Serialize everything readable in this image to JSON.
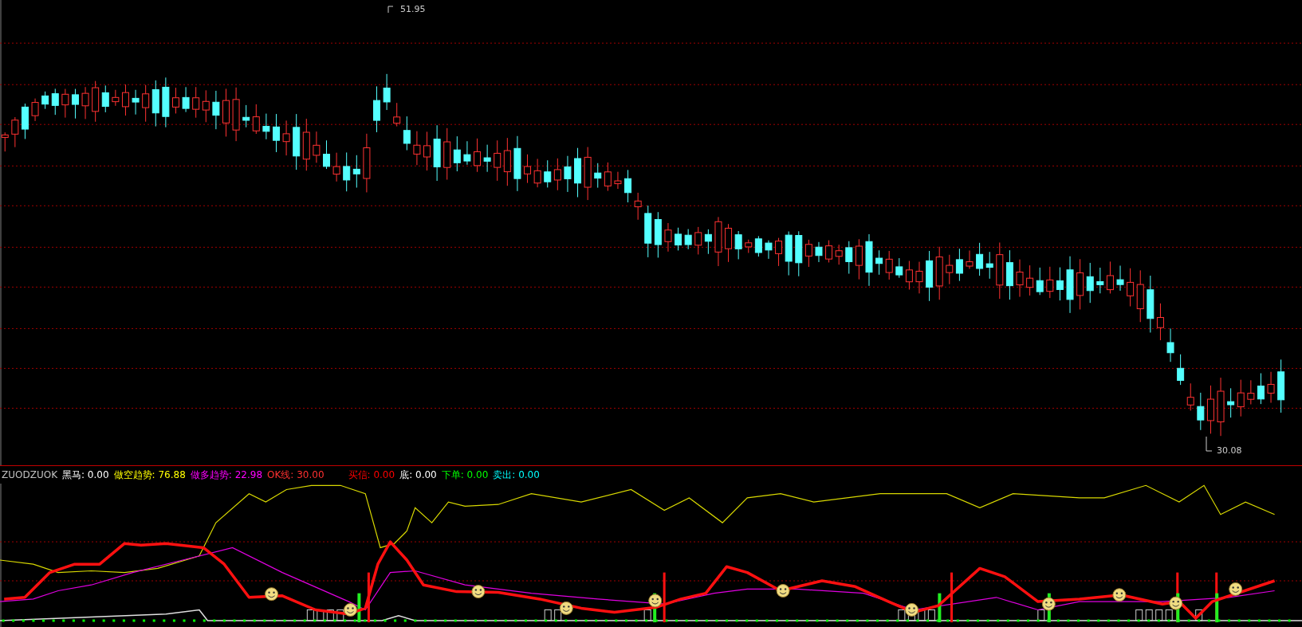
{
  "price_chart": {
    "high_label": "51.95",
    "low_label": "30.08"
  },
  "indicator": {
    "name": "ZUODZUOK",
    "values": [
      {
        "label": "黑马:",
        "value": "0.00",
        "color": "#ffffff"
      },
      {
        "label": "做空趋势:",
        "value": "76.88",
        "color": "#ffff00"
      },
      {
        "label": "做多趋势:",
        "value": "22.98",
        "color": "#ff00ff"
      },
      {
        "label": "OK线:",
        "value": "30.00",
        "color": "#ff3030"
      },
      {
        "label": "买信:",
        "value": "0.00",
        "color": "#ff0000"
      },
      {
        "label": "底:",
        "value": "0.00",
        "color": "#ffffff"
      },
      {
        "label": "下单:",
        "value": "0.00",
        "color": "#00ff00"
      },
      {
        "label": "卖出:",
        "value": "0.00",
        "color": "#00ffff"
      }
    ]
  }
}
